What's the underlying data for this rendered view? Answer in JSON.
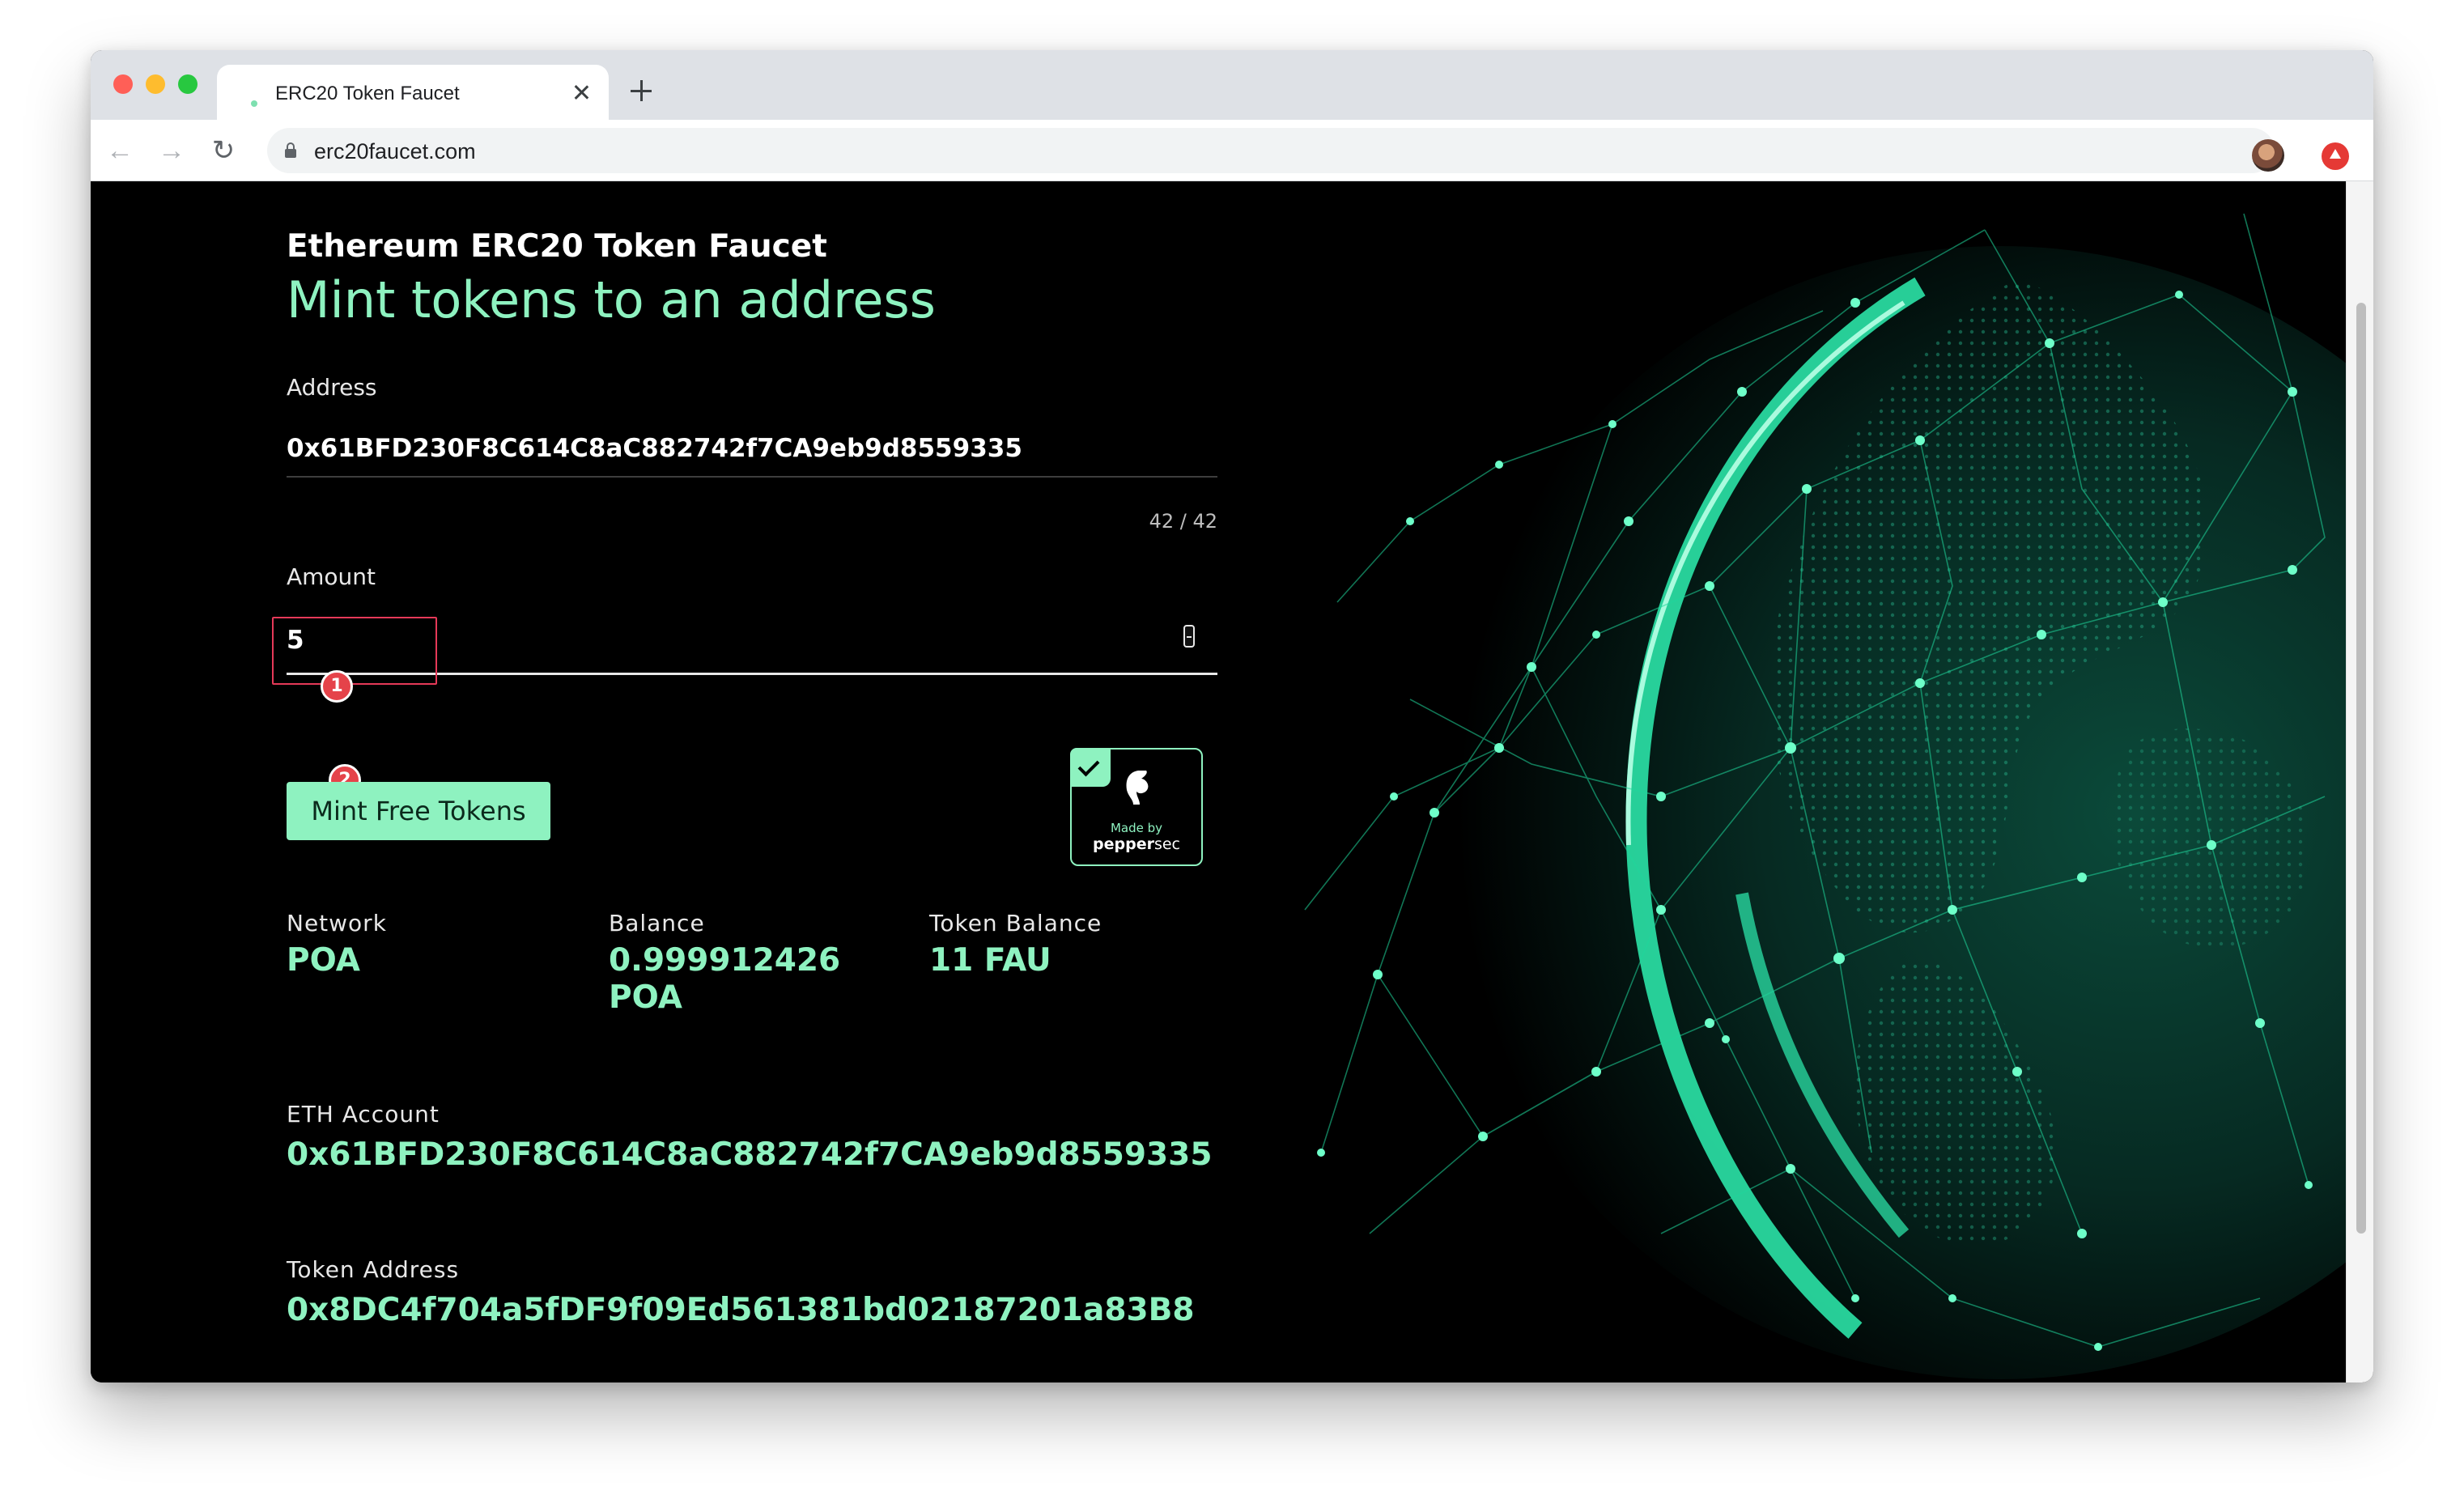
{
  "browser": {
    "tab_title": "ERC20 Token Faucet",
    "url": "erc20faucet.com"
  },
  "page": {
    "app_title": "Ethereum ERC20 Token Faucet",
    "headline": "Mint tokens to an address",
    "address_label": "Address",
    "address_value": "0x61BFD230F8C614C8aC882742f7CA9eb9d8559335",
    "address_counter": "42 / 42",
    "amount_label": "Amount",
    "amount_value": "5",
    "mint_button": "Mint Free Tokens",
    "badge_small": "Made by",
    "badge_brand_bold": "pepper",
    "badge_brand_light": "sec",
    "stats": {
      "network_label": "Network",
      "network_value": "POA",
      "balance_label": "Balance",
      "balance_value": "0.999912426 POA",
      "token_balance_label": "Token Balance",
      "token_balance_value": "11 FAU"
    },
    "eth_account_label": "ETH Account",
    "eth_account_value": "0x61BFD230F8C614C8aC882742f7CA9eb9d8559335",
    "token_address_label": "Token Address",
    "token_address_value": "0x8DC4f704a5fDF9f09Ed561381bd02187201a83B8"
  },
  "annotations": {
    "marker_1": "1",
    "marker_2": "2"
  },
  "colors": {
    "accent": "#8ef2c0",
    "background": "#000000",
    "marker": "#e5434a"
  }
}
